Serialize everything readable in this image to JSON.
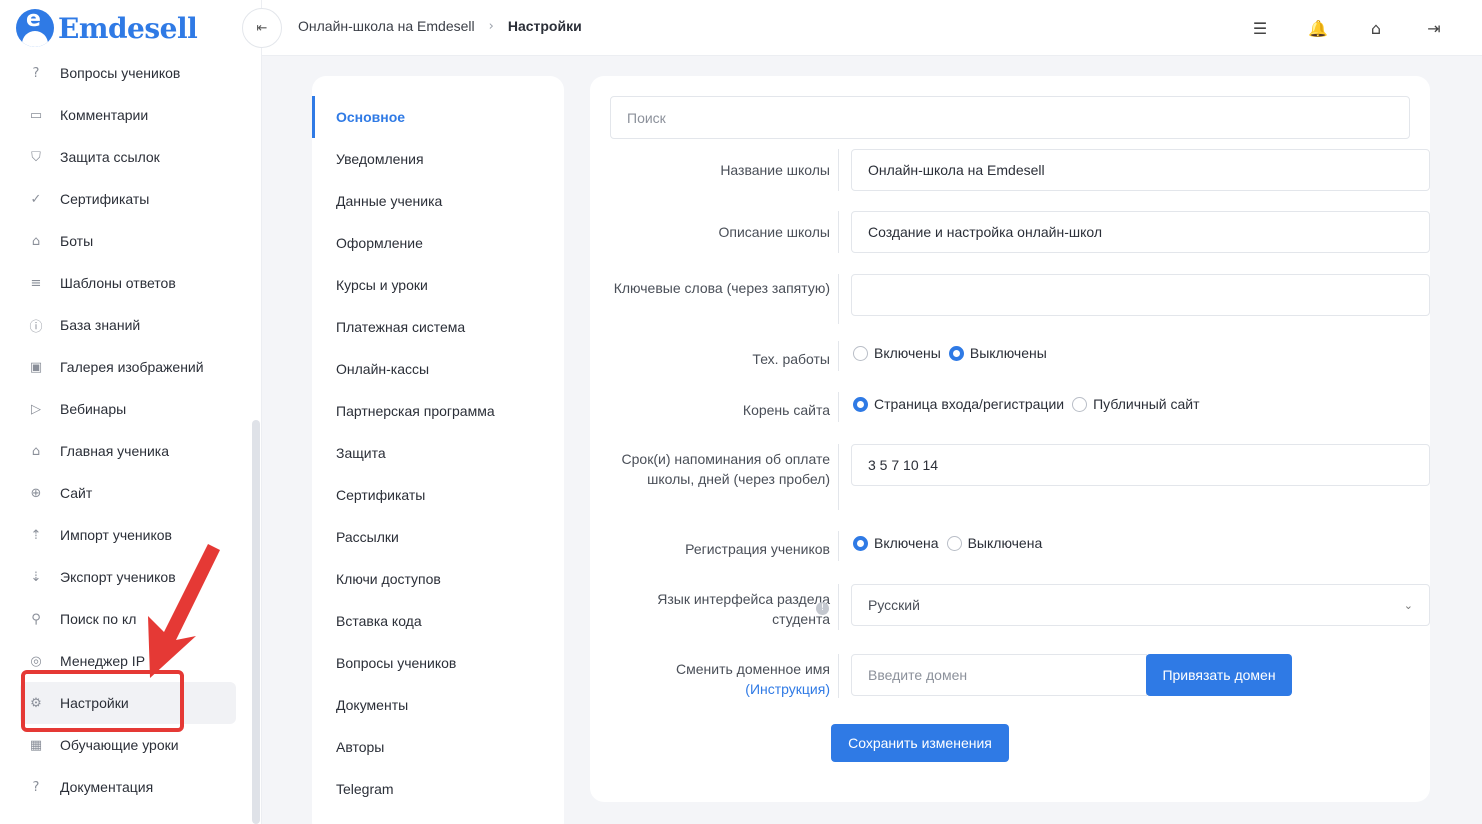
{
  "brand": {
    "name": "Emdesell",
    "logo_letter": "e"
  },
  "sidebar": {
    "items": [
      {
        "label": "Вопросы учеников",
        "icon": "question-circle-icon",
        "glyph": "?"
      },
      {
        "label": "Комментарии",
        "icon": "comment-icon",
        "glyph": "▭"
      },
      {
        "label": "Защита ссылок",
        "icon": "shield-icon",
        "glyph": "⛉"
      },
      {
        "label": "Сертификаты",
        "icon": "certificate-check-icon",
        "glyph": "✓"
      },
      {
        "label": "Боты",
        "icon": "robot-icon",
        "glyph": "⌂"
      },
      {
        "label": "Шаблоны ответов",
        "icon": "list-icon",
        "glyph": "≡"
      },
      {
        "label": "База знаний",
        "icon": "info-circle-icon",
        "glyph": "ⓘ"
      },
      {
        "label": "Галерея изображений",
        "icon": "image-icon",
        "glyph": "▣"
      },
      {
        "label": "Вебинары",
        "icon": "play-icon",
        "glyph": "▷"
      },
      {
        "label": "Главная ученика",
        "icon": "home-icon",
        "glyph": "⌂"
      },
      {
        "label": "Сайт",
        "icon": "globe-icon",
        "glyph": "⊕"
      },
      {
        "label": "Импорт учеников",
        "icon": "upload-icon",
        "glyph": "⇡"
      },
      {
        "label": "Экспорт учеников",
        "icon": "download-icon",
        "glyph": "⇣"
      },
      {
        "label": "Поиск по кл",
        "icon": "search-icon",
        "glyph": "⚲"
      },
      {
        "label": "Менеджер IP",
        "icon": "target-icon",
        "glyph": "◎"
      },
      {
        "label": "Настройки",
        "icon": "gear-icon",
        "glyph": "⚙"
      },
      {
        "label": "Обучающие уроки",
        "icon": "film-icon",
        "glyph": "▦"
      },
      {
        "label": "Документация",
        "icon": "help-square-icon",
        "glyph": "?"
      }
    ]
  },
  "topbar": {
    "collapse_glyph": "⇤",
    "breadcrumb": {
      "link": "Онлайн-школа на Emdesell",
      "separator": "›",
      "current": "Настройки"
    },
    "icons": [
      {
        "name": "sliders-icon",
        "glyph": "☰"
      },
      {
        "name": "bell-icon",
        "glyph": "🔔"
      },
      {
        "name": "home-settings-icon",
        "glyph": "⌂"
      },
      {
        "name": "logout-icon",
        "glyph": "⇥"
      }
    ]
  },
  "settings_menu": {
    "items": [
      "Основное",
      "Уведомления",
      "Данные ученика",
      "Оформление",
      "Курсы и уроки",
      "Платежная система",
      "Онлайн-кассы",
      "Партнерская программа",
      "Защита",
      "Сертификаты",
      "Рассылки",
      "Ключи доступов",
      "Вставка кода",
      "Вопросы учеников",
      "Документы",
      "Авторы",
      "Telegram"
    ],
    "active_index": 0
  },
  "form": {
    "search_placeholder": "Поиск",
    "school_name": {
      "label": "Название школы",
      "value": "Онлайн-школа на Emdesell"
    },
    "school_description": {
      "label": "Описание школы",
      "value": "Создание и настройка онлайн-школ"
    },
    "keywords": {
      "label": "Ключевые слова (через запятую)",
      "value": ""
    },
    "maintenance": {
      "label": "Тех. работы",
      "options": [
        "Включены",
        "Выключены"
      ],
      "selected": 1
    },
    "site_root": {
      "label": "Корень сайта",
      "options": [
        "Страница входа/регистрации",
        "Публичный сайт"
      ],
      "selected": 0
    },
    "reminder_days": {
      "label": "Срок(и) напоминания об оплате школы, дней (через пробел)",
      "value": "3 5 7 10 14"
    },
    "registration": {
      "label": "Регистрация учеников",
      "options": [
        "Включена",
        "Выключена"
      ],
      "selected": 0
    },
    "language": {
      "label": "Язык интерфейса раздела студента",
      "value": "Русский",
      "info_glyph": "!"
    },
    "domain": {
      "label": "Сменить доменное имя",
      "link": "(Инструкция)",
      "placeholder": "Введите домен",
      "button": "Привязать домен"
    },
    "save_button": "Сохранить изменения"
  },
  "colors": {
    "accent": "#2f7ae5",
    "annotation": "#e53935"
  }
}
